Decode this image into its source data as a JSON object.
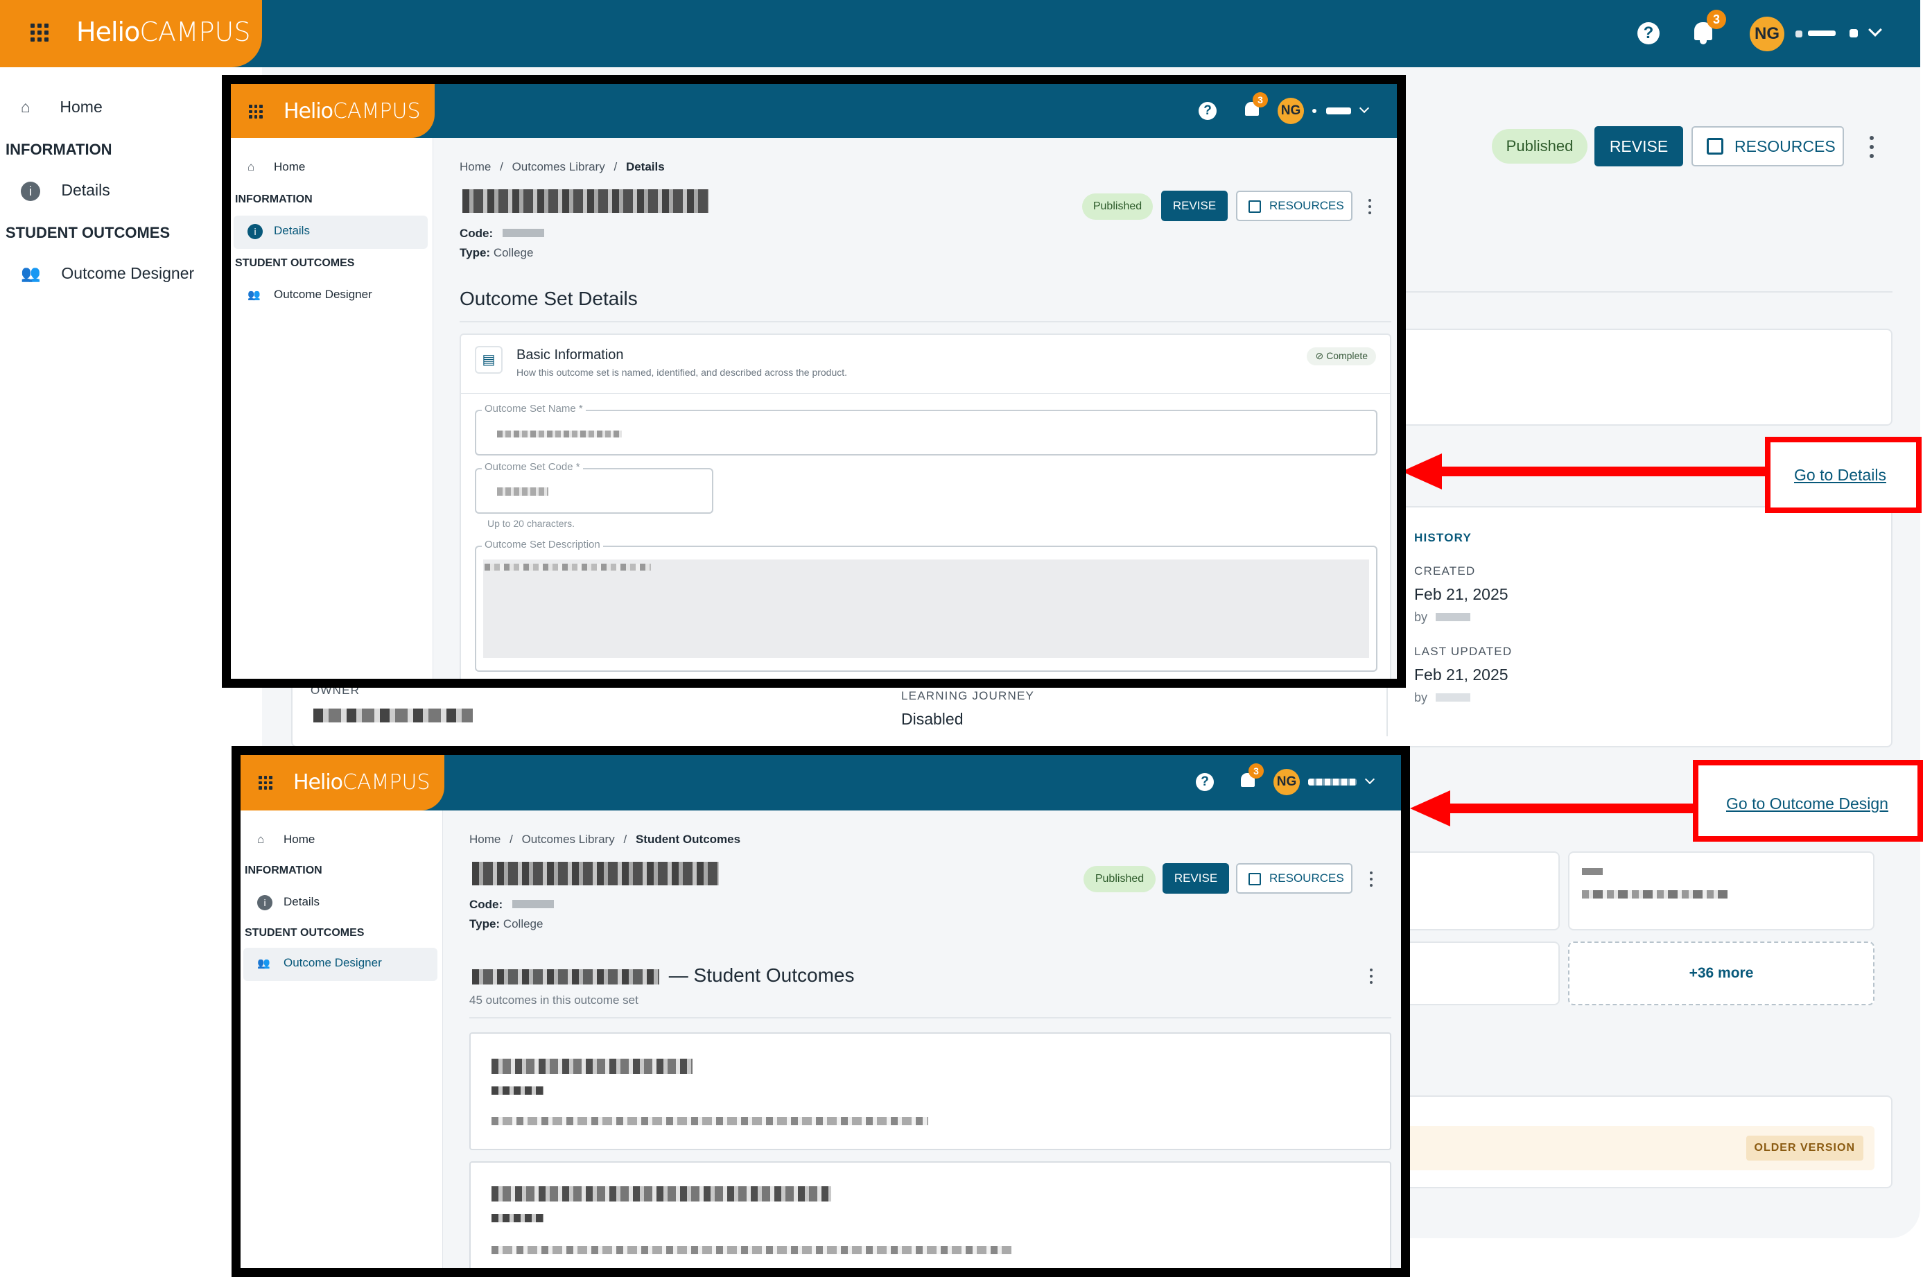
{
  "app": {
    "brand_primary": "Helio",
    "brand_secondary": "CAMPUS",
    "colors": {
      "topbar": "#07587a",
      "brand_orange": "#f28c0f",
      "annotation_red": "#ff0000",
      "published_bg": "#d7efcf"
    },
    "notifications_count": "3",
    "avatar_initials": "NG"
  },
  "sidebar": {
    "home": "Home",
    "information_heading": "INFORMATION",
    "details": "Details",
    "student_outcomes_heading": "STUDENT OUTCOMES",
    "outcome_designer": "Outcome Designer"
  },
  "header_actions": {
    "status": "Published",
    "revise": "REVISE",
    "resources": "RESOURCES"
  },
  "background_page": {
    "owner_label": "OWNER",
    "learning_journey_label": "LEARNING JOURNEY",
    "learning_journey_value": "Disabled",
    "history_heading": "HISTORY",
    "created_label": "CREATED",
    "created_value": "Feb 21, 2025",
    "created_by": "by",
    "last_updated_label": "LAST UPDATED",
    "last_updated_value": "Feb 21, 2025",
    "updated_by": "by",
    "more_outcomes": "+36 more",
    "older_version_badge": "OLDER VERSION"
  },
  "annotations": {
    "go_to_details": "Go to Details",
    "go_to_outcome_design": "Go to Outcome Design"
  },
  "details_view": {
    "breadcrumb": {
      "home": "Home",
      "library": "Outcomes Library",
      "current": "Details",
      "sep": "/"
    },
    "code_label": "Code:",
    "type_label": "Type:",
    "type_value": "College",
    "section_title": "Outcome Set Details",
    "basic_info_title": "Basic Information",
    "basic_info_desc": "How this outcome set is named, identified, and described across the product.",
    "complete_label": "Complete",
    "name_label": "Outcome Set Name *",
    "code_field_label": "Outcome Set Code *",
    "code_hint": "Up to 20 characters.",
    "description_label": "Outcome Set Description"
  },
  "outcomes_view": {
    "breadcrumb": {
      "home": "Home",
      "library": "Outcomes Library",
      "current": "Student Outcomes",
      "sep": "/"
    },
    "code_label": "Code:",
    "type_label": "Type:",
    "type_value": "College",
    "section_suffix": "— Student Outcomes",
    "outcome_count": "45 outcomes in this outcome set"
  }
}
